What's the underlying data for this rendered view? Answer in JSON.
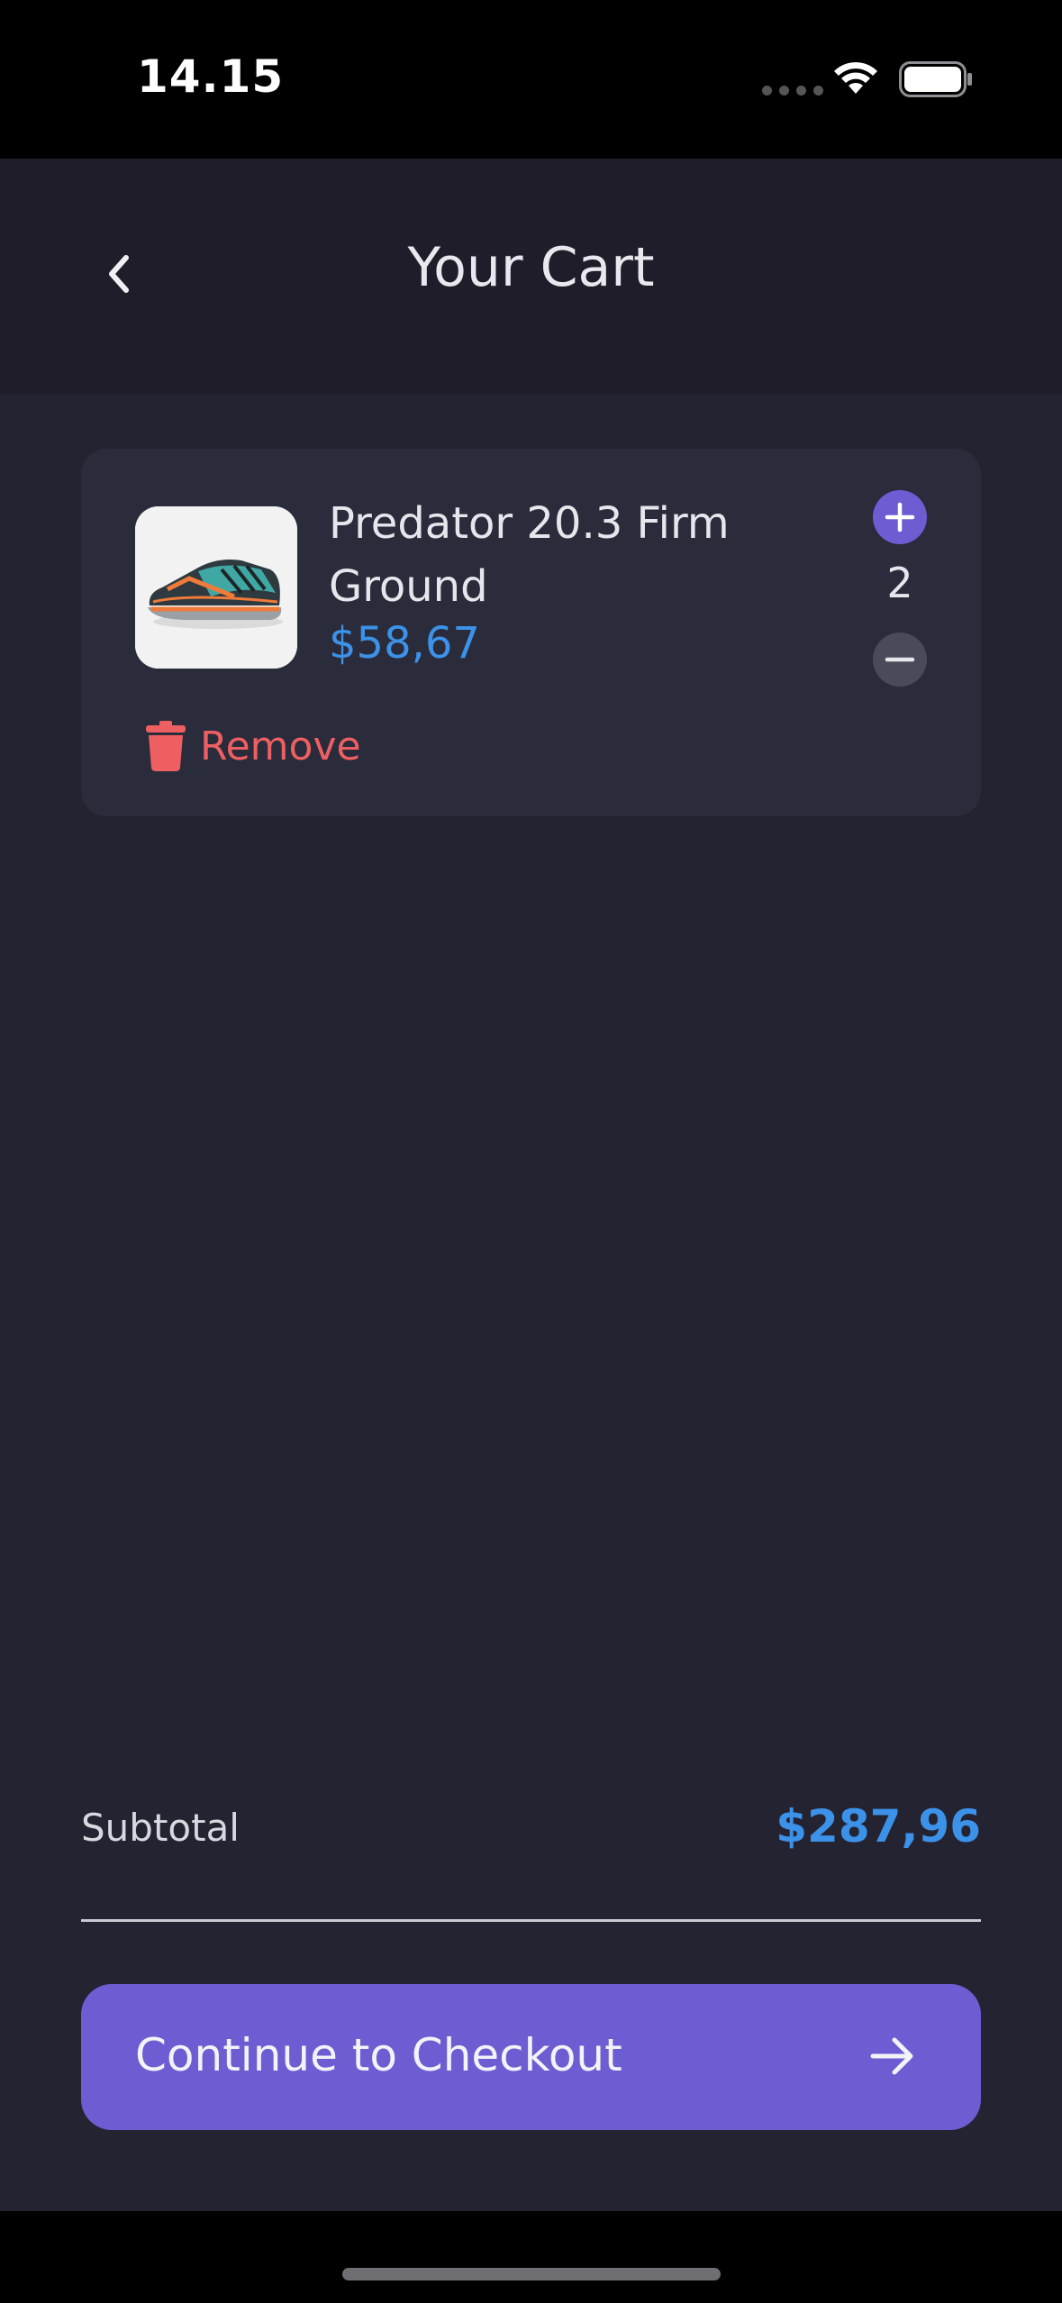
{
  "status_bar": {
    "time": "14.15"
  },
  "header": {
    "title": "Your Cart",
    "back_icon": "chevron-left-icon"
  },
  "cart": {
    "items": [
      {
        "name": "Predator 20.3 Firm Ground",
        "price": "$58,67",
        "quantity": "2",
        "remove_label": "Remove"
      }
    ]
  },
  "summary": {
    "subtotal_label": "Subtotal",
    "subtotal_value": "$287,96"
  },
  "checkout": {
    "label": "Continue to Checkout",
    "icon": "arrow-right-icon"
  },
  "colors": {
    "accent": "#6C5DD3",
    "price": "#3C92E8",
    "danger": "#EE5F62",
    "background": "#242331",
    "card": "#2A2B3B"
  }
}
